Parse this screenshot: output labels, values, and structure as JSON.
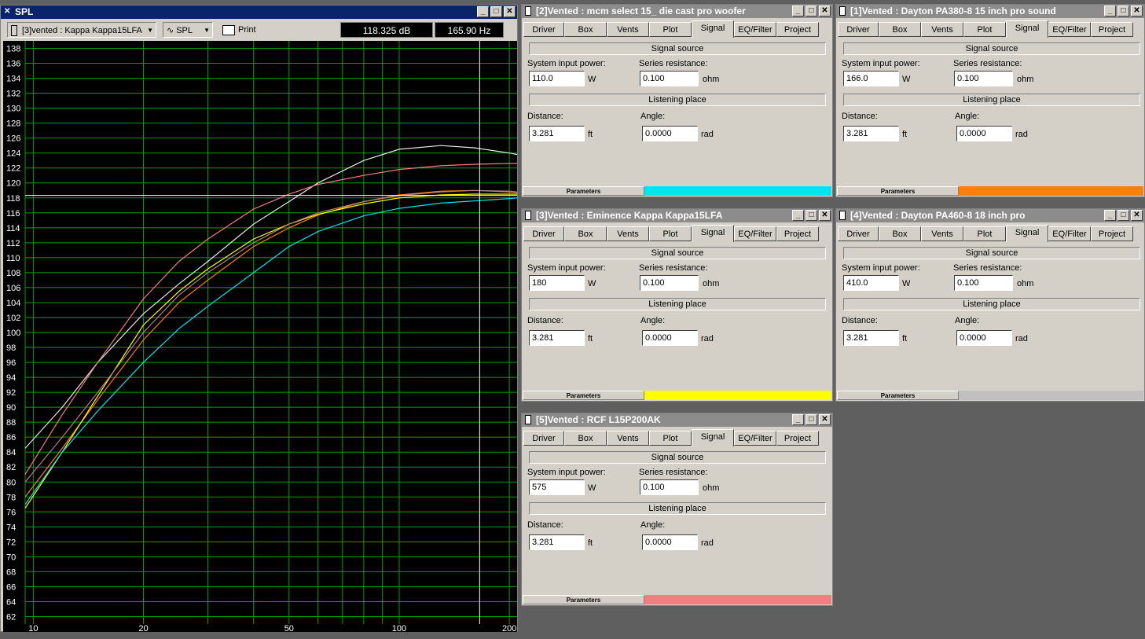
{
  "spl_window": {
    "title": "SPL",
    "driver_select": "[3]vented : Kappa Kappa15LFA",
    "mode_select": "SPL",
    "print_label": "Print",
    "readout_db": "118.325 dB",
    "readout_hz": "165.90 Hz"
  },
  "common": {
    "tabs": [
      "Driver",
      "Box",
      "Vents",
      "Plot",
      "Signal",
      "EQ/Filter",
      "Project"
    ],
    "active_tab": "Signal",
    "signal_source": "Signal source",
    "system_input_power": "System input power:",
    "series_resistance": "Series resistance:",
    "listening_place": "Listening place",
    "distance": "Distance:",
    "angle": "Angle:",
    "unit_w": "W",
    "unit_ohm": "ohm",
    "unit_ft": "ft",
    "unit_rad": "rad",
    "parameters": "Parameters",
    "min_btn": "_",
    "max_btn": "□",
    "close_btn": "✕"
  },
  "panels": [
    {
      "id": "p2",
      "title": "[2]Vented : mcm select 15_ die cast pro woofer",
      "power": "110.0",
      "resistance": "0.100",
      "distance": "3.281",
      "angle": "0.0000",
      "color": "#00e5ee"
    },
    {
      "id": "p1",
      "title": "[1]Vented : Dayton PA380-8 15 inch pro sound",
      "power": "166.0",
      "resistance": "0.100",
      "distance": "3.281",
      "angle": "0.0000",
      "color": "#ff7f00"
    },
    {
      "id": "p3",
      "title": "[3]Vented : Eminence Kappa Kappa15LFA",
      "power": "180",
      "resistance": "0.100",
      "distance": "3.281",
      "angle": "0.0000",
      "color": "#ffff00"
    },
    {
      "id": "p4",
      "title": "[4]Vented : Dayton PA460-8 18 inch pro",
      "power": "410.0",
      "resistance": "0.100",
      "distance": "3.281",
      "angle": "0.0000",
      "color": "#c0c0c0"
    },
    {
      "id": "p5",
      "title": "[5]Vented : RCF L15P200AK",
      "power": "575",
      "resistance": "0.100",
      "distance": "3.281",
      "angle": "0.0000",
      "color": "#f08080"
    }
  ],
  "chart_data": {
    "type": "line",
    "xscale": "log",
    "xlim": [
      9.5,
      210
    ],
    "ylim": [
      61,
      139
    ],
    "grid": true,
    "yticks": [
      62,
      64,
      66,
      68,
      70,
      72,
      74,
      76,
      78,
      80,
      82,
      84,
      86,
      88,
      90,
      92,
      94,
      96,
      98,
      100,
      102,
      104,
      106,
      108,
      110,
      112,
      114,
      116,
      118,
      120,
      122,
      124,
      126,
      128,
      130,
      132,
      134,
      136,
      138
    ],
    "xtick_labels": [
      {
        "x": 10,
        "label": "10"
      },
      {
        "x": 20,
        "label": "20"
      },
      {
        "x": 50,
        "label": "50"
      },
      {
        "x": 100,
        "label": "100"
      },
      {
        "x": 200,
        "label": "200"
      }
    ],
    "cursor": {
      "x": 165.9,
      "y": 118.325
    },
    "series": [
      {
        "color": "#e8e8e8",
        "x": [
          9.5,
          12,
          15,
          20,
          25,
          30,
          40,
          50,
          60,
          80,
          100,
          130,
          160,
          200,
          210
        ],
        "values": [
          84.5,
          90,
          96,
          102.5,
          106.5,
          109.5,
          114.5,
          117.5,
          120,
          123,
          124.5,
          125,
          124.7,
          124,
          123.8
        ]
      },
      {
        "color": "#f08080",
        "x": [
          9.5,
          12,
          15,
          20,
          25,
          30,
          40,
          50,
          60,
          80,
          100,
          130,
          160,
          200,
          210
        ],
        "values": [
          81,
          89,
          96,
          104.5,
          109.5,
          112.5,
          116.5,
          118.5,
          119.8,
          121,
          121.8,
          122.3,
          122.5,
          122.6,
          122.6
        ]
      },
      {
        "color": "#ff7f00",
        "x": [
          9.5,
          12,
          15,
          20,
          25,
          30,
          40,
          50,
          60,
          80,
          100,
          130,
          160,
          200,
          210
        ],
        "values": [
          78,
          84.5,
          91,
          99,
          104,
          107,
          111.5,
          114,
          115.7,
          117.5,
          118.4,
          118.9,
          119,
          118.8,
          118.7
        ]
      },
      {
        "color": "#ffff00",
        "x": [
          9.5,
          12,
          15,
          20,
          25,
          30,
          40,
          50,
          60,
          80,
          100,
          130,
          160,
          200,
          210
        ],
        "values": [
          76.5,
          84,
          91.5,
          101,
          105.5,
          108.5,
          112.5,
          114.5,
          115.8,
          117.2,
          118,
          118.4,
          118.5,
          118.5,
          118.5
        ]
      },
      {
        "color": "#00e5ee",
        "x": [
          9.5,
          12,
          15,
          20,
          25,
          30,
          40,
          50,
          60,
          80,
          100,
          130,
          160,
          200,
          210
        ],
        "values": [
          77,
          84,
          89.5,
          96,
          100.5,
          103.5,
          108,
          111.5,
          113.5,
          115.6,
          116.6,
          117.3,
          117.6,
          117.9,
          118
        ]
      },
      {
        "color": "#b08080",
        "x": [
          9.5,
          12,
          15,
          20,
          25,
          30,
          40,
          50,
          60,
          80,
          100,
          130,
          160,
          200,
          210
        ],
        "values": [
          80,
          86,
          92,
          100,
          105,
          108,
          112,
          114.5,
          116,
          117.5,
          118.3,
          118.8,
          119,
          118.9,
          118.8
        ]
      }
    ]
  }
}
